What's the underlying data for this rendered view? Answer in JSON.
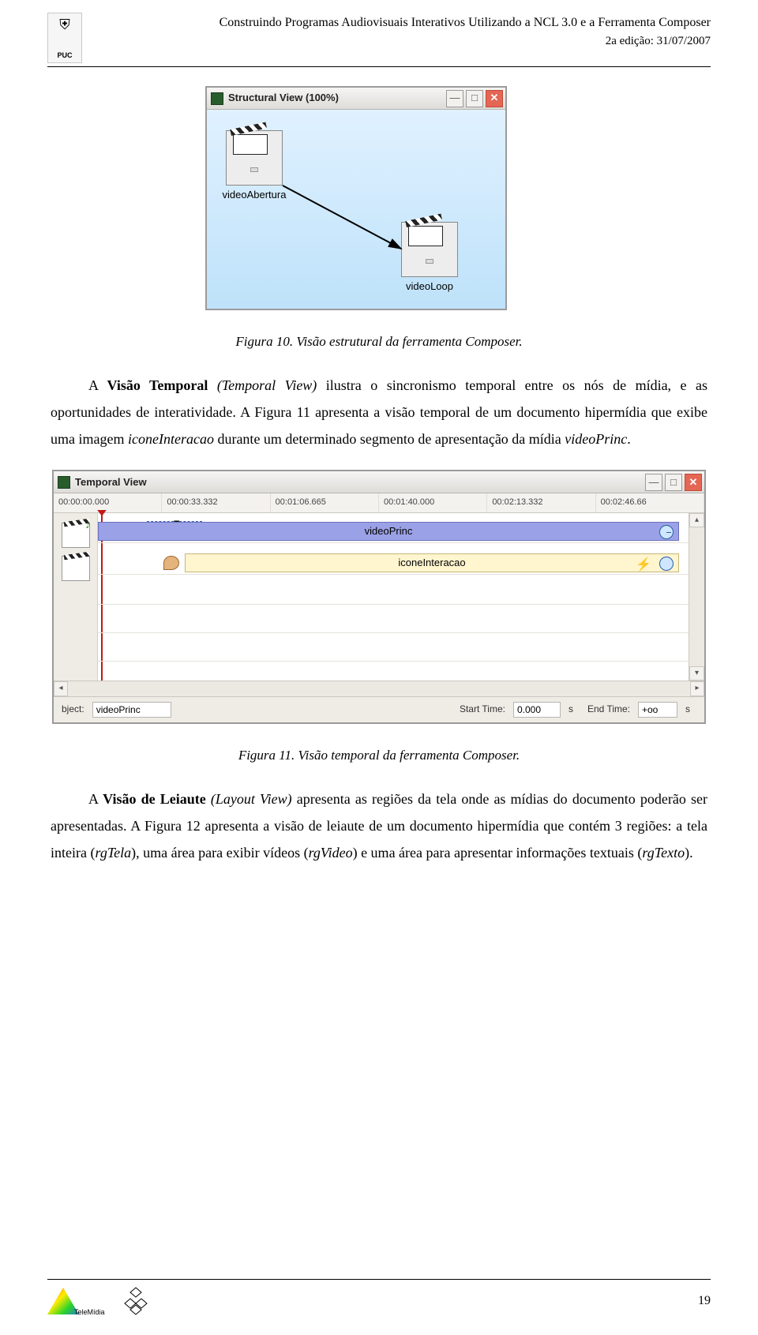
{
  "header": {
    "title": "Construindo Programas Audiovisuais Interativos Utilizando a NCL 3.0 e a Ferramenta Composer",
    "edition": "2a edição: 31/07/2007",
    "institution_short": "PUC"
  },
  "figure10": {
    "window_title": "Structural View (100%)",
    "node1_label": "videoAbertura",
    "node2_label": "videoLoop",
    "caption": "Figura 10. Visão estrutural da ferramenta Composer."
  },
  "paragraph1": {
    "lead_bold": "Visão Temporal",
    "lead_ital": "(Temporal View)",
    "text_before": "A ",
    "text_after_lead": " ilustra o sincronismo temporal entre os nós de mídia, e as oportunidades de interatividade. A Figura 11 apresenta a visão temporal de um documento hipermídia que exibe uma imagem ",
    "ital_1": "iconeInteracao",
    "text_mid": " durante um determinado segmento de apresentação da mídia ",
    "ital_2": "videoPrinc",
    "text_end": "."
  },
  "figure11": {
    "window_title": "Temporal View",
    "ruler": [
      "00:00:00.000",
      "00:00:33.332",
      "00:01:06.665",
      "00:01:40.000",
      "00:02:13.332",
      "00:02:46.66"
    ],
    "track_vp_label": "videoPrinc",
    "track_ii_label": "iconeInteracao",
    "bracket_t": "T",
    "status": {
      "object_label": "bject:",
      "object_value": "videoPrinc",
      "start_label": "Start Time:",
      "start_value": "0.000",
      "start_unit": "s",
      "end_label": "End Time:",
      "end_value": "+oo",
      "end_unit": "s"
    },
    "caption": "Figura 11. Visão temporal da ferramenta Composer."
  },
  "paragraph2": {
    "text_before": "A ",
    "lead_bold": "Visão de Leiaute",
    "lead_ital": "(Layout View)",
    "text_after_lead": " apresenta as regiões da tela onde as mídias do documento poderão ser apresentadas. A Figura 12 apresenta a visão de leiaute de um documento hipermídia que contém 3 regiões: a tela inteira (",
    "ital_1": "rgTela",
    "text_mid1": "), uma área para exibir vídeos (",
    "ital_2": "rgVideo",
    "text_mid2": ") e uma área para apresentar informações textuais (",
    "ital_3": "rgTexto",
    "text_end": ")."
  },
  "footer": {
    "logo_label": "TeleMídia",
    "page_number": "19"
  }
}
